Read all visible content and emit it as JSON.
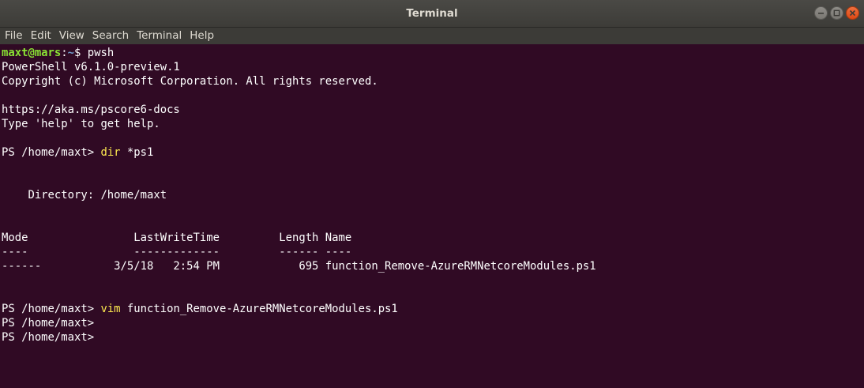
{
  "window": {
    "title": "Terminal"
  },
  "menubar": {
    "items": [
      "File",
      "Edit",
      "View",
      "Search",
      "Terminal",
      "Help"
    ]
  },
  "terminal": {
    "bash_prompt": {
      "user_host": "maxt@mars",
      "path_sep": ":",
      "path": "~",
      "symbol": "$ ",
      "command": "pwsh"
    },
    "lines": [
      "PowerShell v6.1.0-preview.1",
      "Copyright (c) Microsoft Corporation. All rights reserved.",
      "",
      "https://aka.ms/pscore6-docs",
      "Type 'help' to get help.",
      ""
    ],
    "ps_prompt": "PS /home/maxt> ",
    "cmd1_name": "dir",
    "cmd1_args": " *ps1",
    "directory_line": "    Directory: /home/maxt",
    "table": {
      "header": "Mode                LastWriteTime         Length Name",
      "separator": "----                -------------         ------ ----",
      "rows": [
        "------           3/5/18   2:54 PM            695 function_Remove-AzureRMNetcoreModules.ps1"
      ]
    },
    "cmd2_name": "vim",
    "cmd2_args": " function_Remove-AzureRMNetcoreModules.ps1",
    "trailing_prompts": [
      "PS /home/maxt>",
      "PS /home/maxt>"
    ]
  },
  "colors": {
    "background": "#300a24",
    "prompt_user": "#8ae234",
    "prompt_path": "#729fcf",
    "command": "#fce94f",
    "text": "#ffffff"
  }
}
